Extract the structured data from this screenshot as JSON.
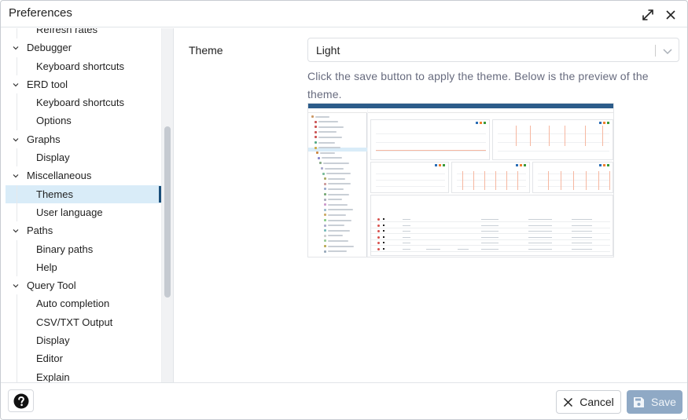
{
  "dialog": {
    "title": "Preferences",
    "maximize_icon": "expand-diagonal-icon",
    "close_icon": "close-icon"
  },
  "sidebar": {
    "items": [
      {
        "label": "Refresh rates",
        "level": "child",
        "selected": false
      },
      {
        "label": "Debugger",
        "level": "parent",
        "expanded": true
      },
      {
        "label": "Keyboard shortcuts",
        "level": "child",
        "selected": false
      },
      {
        "label": "ERD tool",
        "level": "parent",
        "expanded": true
      },
      {
        "label": "Keyboard shortcuts",
        "level": "child",
        "selected": false
      },
      {
        "label": "Options",
        "level": "child",
        "selected": false
      },
      {
        "label": "Graphs",
        "level": "parent",
        "expanded": true
      },
      {
        "label": "Display",
        "level": "child",
        "selected": false
      },
      {
        "label": "Miscellaneous",
        "level": "parent",
        "expanded": true
      },
      {
        "label": "Themes",
        "level": "child",
        "selected": true
      },
      {
        "label": "User language",
        "level": "child",
        "selected": false
      },
      {
        "label": "Paths",
        "level": "parent",
        "expanded": true
      },
      {
        "label": "Binary paths",
        "level": "child",
        "selected": false
      },
      {
        "label": "Help",
        "level": "child",
        "selected": false
      },
      {
        "label": "Query Tool",
        "level": "parent",
        "expanded": true
      },
      {
        "label": "Auto completion",
        "level": "child",
        "selected": false
      },
      {
        "label": "CSV/TXT Output",
        "level": "child",
        "selected": false
      },
      {
        "label": "Display",
        "level": "child",
        "selected": false
      },
      {
        "label": "Editor",
        "level": "child",
        "selected": false
      },
      {
        "label": "Explain",
        "level": "child",
        "selected": false
      }
    ]
  },
  "content": {
    "theme_label": "Theme",
    "theme_value": "Light",
    "help_text": "Click the save button to apply the theme. Below is the preview of the theme.",
    "preview_alt": "Light theme preview"
  },
  "footer": {
    "help_icon": "question-circle-icon",
    "cancel_label": "Cancel",
    "save_label": "Save"
  },
  "colors": {
    "selected_bg": "#d9ecf8",
    "selected_indicator": "#1a4e7a",
    "save_button_disabled": "#8fa9c5",
    "preview_header": "#2c5c8a"
  }
}
